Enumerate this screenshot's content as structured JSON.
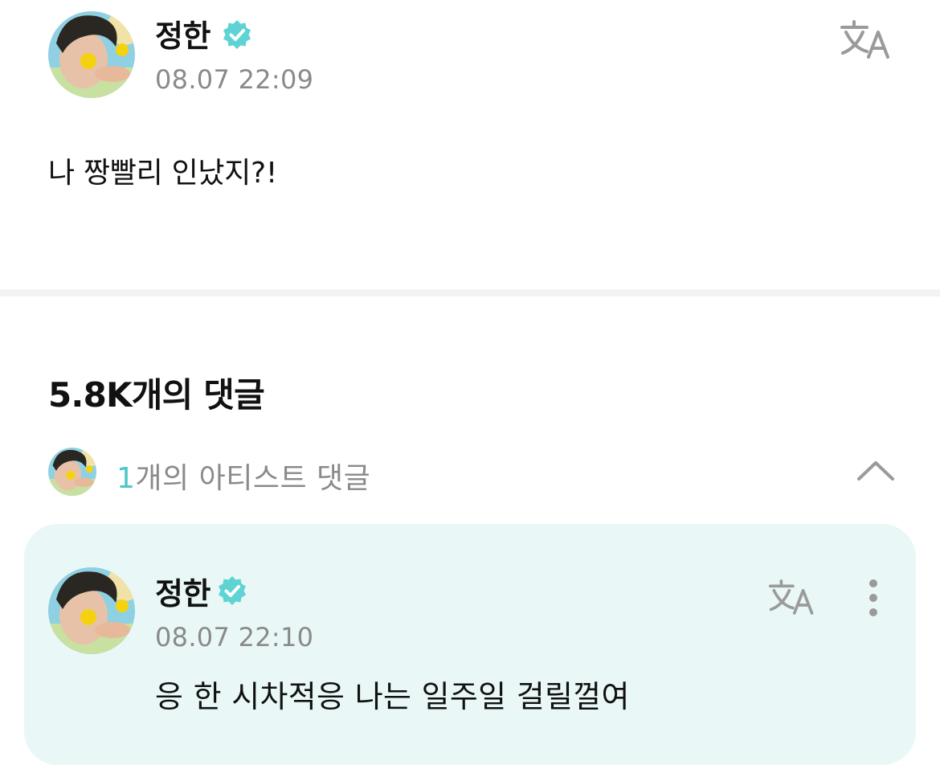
{
  "post": {
    "author": "정한",
    "timestamp": "08.07 22:09",
    "text": "나 짱빨리 인났지?!"
  },
  "comments": {
    "title": "5.8K개의 댓글",
    "artist_summary": {
      "count": "1",
      "label": "개의 아티스트 댓글"
    },
    "items": [
      {
        "author": "정한",
        "timestamp": "08.07 22:10",
        "text": "응 한 시차적응 나는 일주일 걸릴껄여"
      }
    ]
  },
  "icons": {
    "verified": "verified-badge-icon",
    "translate": "translate-icon",
    "collapse": "chevron-up-icon",
    "more": "more-vertical-icon"
  },
  "colors": {
    "accent": "#4fc6c6",
    "card_background": "#e9f8f6",
    "muted_text": "#8a8a8a"
  }
}
